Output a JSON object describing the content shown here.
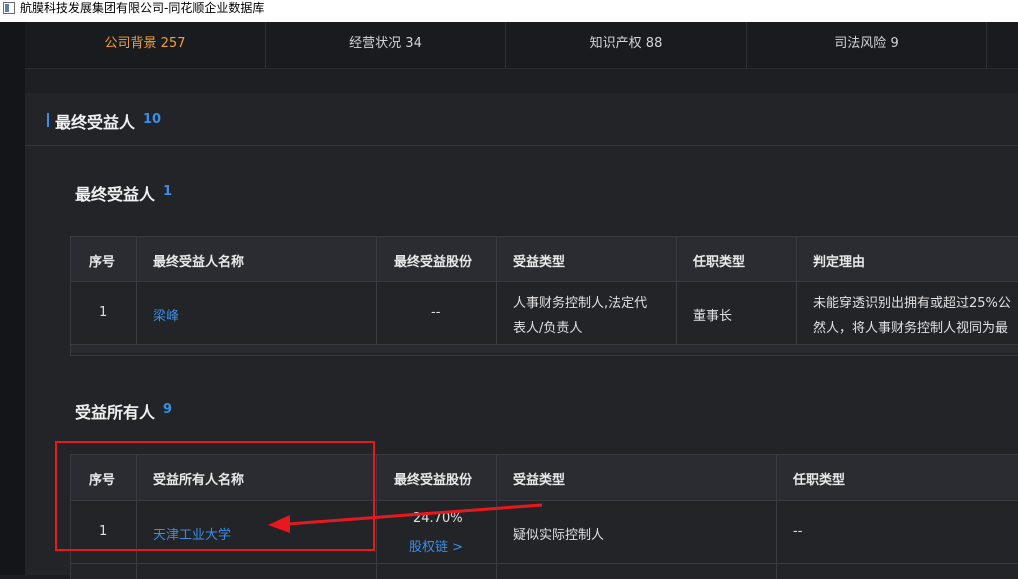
{
  "window": {
    "title": "航膜科技发展集团有限公司-同花顺企业数据库"
  },
  "tabs": [
    {
      "label": "公司背景",
      "count": "257",
      "active": true
    },
    {
      "label": "经营状况",
      "count": "34",
      "active": false
    },
    {
      "label": "知识产权",
      "count": "88",
      "active": false
    },
    {
      "label": "司法风险",
      "count": "9",
      "active": false
    }
  ],
  "section": {
    "title": "最终受益人",
    "count": "10"
  },
  "ubo": {
    "title": "最终受益人",
    "count": "1",
    "headers": [
      "序号",
      "最终受益人名称",
      "最终受益股份",
      "受益类型",
      "任职类型",
      "判定理由"
    ],
    "rows": [
      {
        "index": "1",
        "name": "梁峰",
        "shares": "--",
        "type_line1": "人事财务控制人,法定代",
        "type_line2": "表人/负责人",
        "position": "董事长",
        "reason_line1": "未能穿透识别出拥有或超过25%公",
        "reason_line2": "然人，将人事财务控制人视同为最"
      }
    ]
  },
  "beneficial_owners": {
    "title": "受益所有人",
    "count": "9",
    "headers": [
      "序号",
      "受益所有人名称",
      "最终受益股份",
      "受益类型",
      "任职类型"
    ],
    "rows": [
      {
        "index": "1",
        "name": "天津工业大学",
        "shares": "24.70%",
        "equity_link": "股权链 >",
        "type": "疑似实际控制人",
        "position": "--"
      }
    ]
  },
  "colors": {
    "accent": "#3a8ee6",
    "active_tab": "#f29f38",
    "annotation": "#e8191e"
  }
}
